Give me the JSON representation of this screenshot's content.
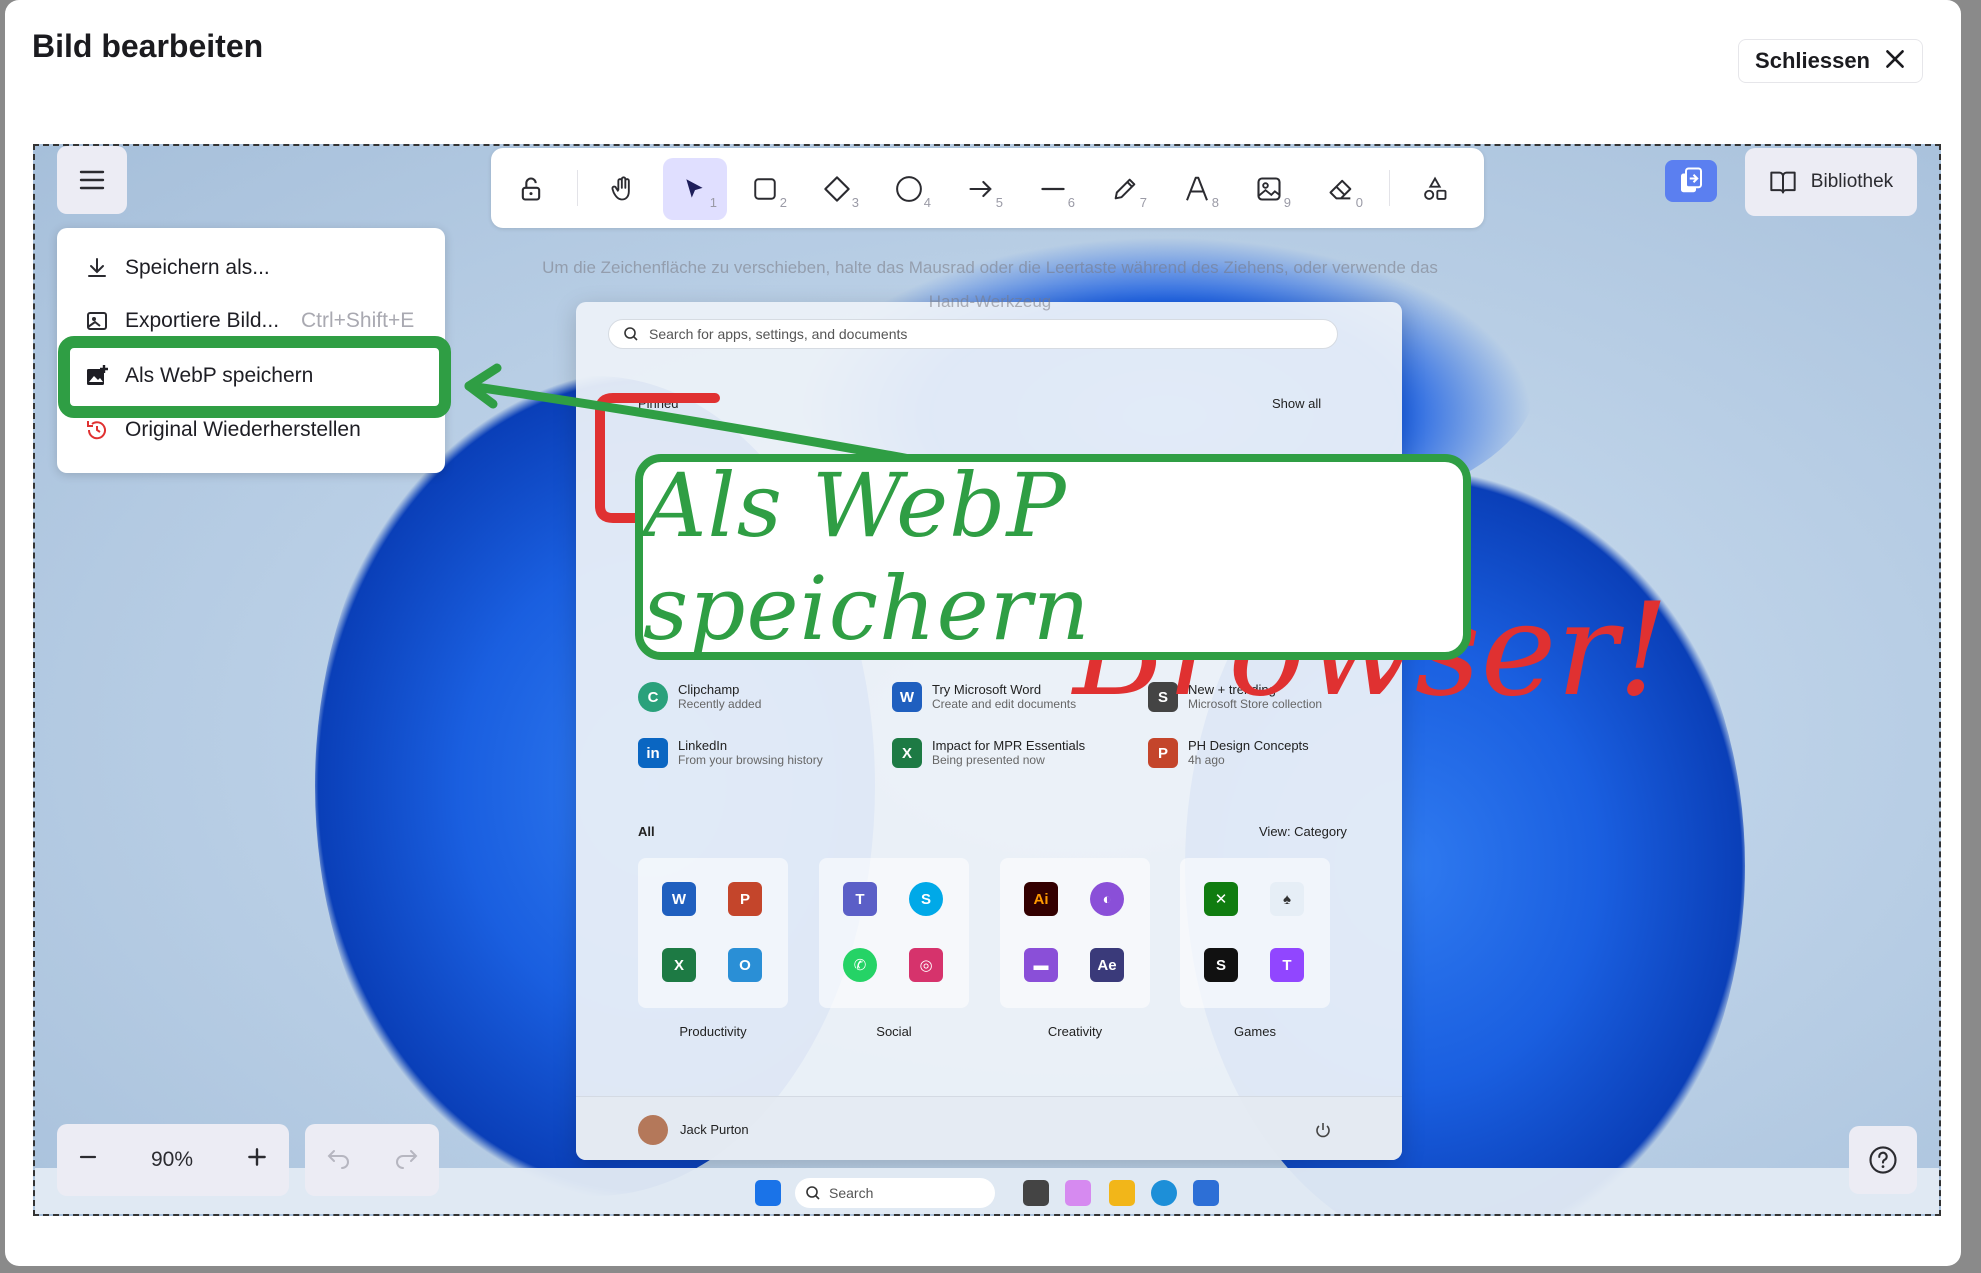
{
  "dialog": {
    "title": "Bild bearbeiten",
    "close_label": "Schliessen"
  },
  "toolbar": {
    "tools": [
      {
        "name": "lock-icon",
        "num": ""
      },
      {
        "name": "hand-icon",
        "num": ""
      },
      {
        "name": "selection-icon",
        "num": "1",
        "active": true
      },
      {
        "name": "rectangle-icon",
        "num": "2"
      },
      {
        "name": "diamond-icon",
        "num": "3"
      },
      {
        "name": "ellipse-icon",
        "num": "4"
      },
      {
        "name": "arrow-icon",
        "num": "5"
      },
      {
        "name": "line-icon",
        "num": "6"
      },
      {
        "name": "pencil-icon",
        "num": "7"
      },
      {
        "name": "text-icon",
        "num": "8"
      },
      {
        "name": "image-icon",
        "num": "9"
      },
      {
        "name": "eraser-icon",
        "num": "0"
      },
      {
        "name": "shapes-icon",
        "num": ""
      }
    ],
    "library_label": "Bibliothek"
  },
  "hint": {
    "line1": "Um die Zeichenfläche zu verschieben, halte das Mausrad oder die Leertaste während des Ziehens, oder verwende das",
    "line2": "Hand-Werkzeug"
  },
  "menu": {
    "items": [
      {
        "label": "Speichern als...",
        "shortcut": ""
      },
      {
        "label": "Exportiere Bild...",
        "shortcut": "Ctrl+Shift+E"
      },
      {
        "label": "Als WebP speichern",
        "shortcut": ""
      },
      {
        "label": "Original Wiederherstellen",
        "shortcut": ""
      }
    ]
  },
  "annotations": {
    "callout_text": "Als WebP speichern",
    "browser_text": "Browser!",
    "green": "#2f9e44",
    "red": "#e03131"
  },
  "startmenu": {
    "search_placeholder": "Search for apps, settings, and documents",
    "pinned_label": "Pinned",
    "show_all": "Show all",
    "recommended": [
      {
        "title": "Clipchamp",
        "sub": "Recently added"
      },
      {
        "title": "Try Microsoft Word",
        "sub": "Create and edit documents"
      },
      {
        "title": "New + trending",
        "sub": "Microsoft Store collection"
      },
      {
        "title": "LinkedIn",
        "sub": "From your browsing history"
      },
      {
        "title": "Impact for MPR Essentials",
        "sub": "Being presented now"
      },
      {
        "title": "PH Design Concepts",
        "sub": "4h ago"
      }
    ],
    "all_label": "All",
    "view_label": "View: Category",
    "groups": [
      "Productivity",
      "Social",
      "Creativity",
      "Games"
    ],
    "user_name": "Jack Purton"
  },
  "taskbar": {
    "search_label": "Search"
  },
  "footer": {
    "zoom": "90%"
  }
}
